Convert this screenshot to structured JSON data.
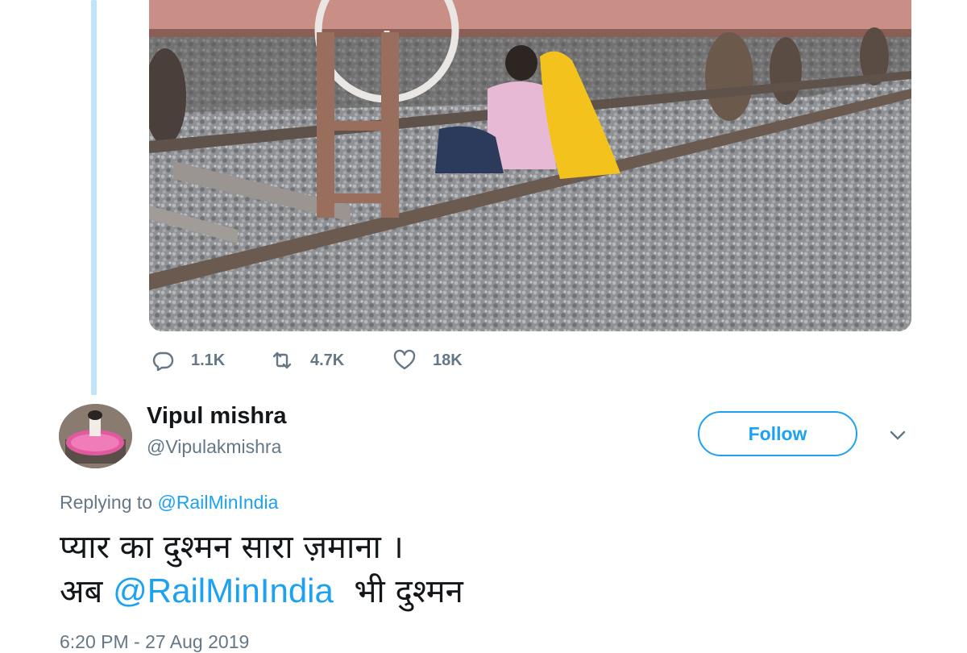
{
  "parent_tweet": {
    "actions": {
      "reply": {
        "icon": "reply-icon",
        "count": "1.1K"
      },
      "retweet": {
        "icon": "retweet-icon",
        "count": "4.7K"
      },
      "like": {
        "icon": "heart-icon",
        "count": "18K"
      }
    }
  },
  "reply_tweet": {
    "author": {
      "name": "Vipul mishra",
      "handle": "@Vipulakmishra"
    },
    "follow_label": "Follow",
    "replying_prefix": "Replying to",
    "replying_to": "@RailMinIndia",
    "text_line1": "प्यार का दुश्मन सारा ज़माना ।",
    "text_line2_prefix": "अब",
    "text_mention": "@RailMinIndia",
    "text_line2_suffix": "भी दुश्मन",
    "timestamp": "6:20 PM - 27 Aug 2019"
  },
  "colors": {
    "accent": "#1da1f2",
    "secondary_text": "#657786",
    "thread_line": "#bfe4fa"
  }
}
